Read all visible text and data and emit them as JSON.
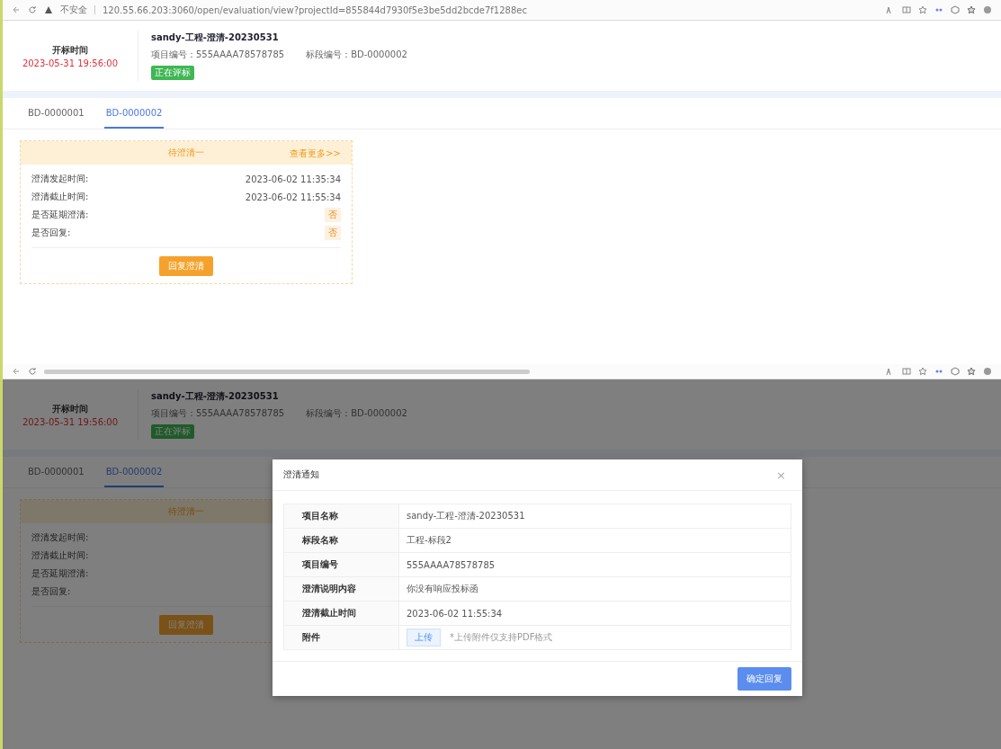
{
  "screens": [
    {
      "dimmed": false,
      "browser": {
        "security": "不安全",
        "url": "120.55.66.203:3060/open/evaluation/view?projectId=855844d7930f5e3be5dd2bcde7f1288ec"
      },
      "header": {
        "label": "开标时间",
        "time": "2023-05-31 19:56:00",
        "title": "sandy-工程-澄清-20230531",
        "meta": [
          "项目编号：555AAAA78578785",
          "标段编号：BD-0000002"
        ],
        "status": "正在评标"
      },
      "tabs": [
        {
          "label": "BD-0000001",
          "selected": false
        },
        {
          "label": "BD-0000002",
          "selected": true
        }
      ],
      "card": {
        "title": "待澄清一",
        "link": "查看更多>>",
        "rows": [
          {
            "label": "澄清发起时间:",
            "value": "2023-06-02 11:35:34",
            "kind": "text"
          },
          {
            "label": "澄清截止时间:",
            "value": "2023-06-02 11:55:34",
            "kind": "text"
          },
          {
            "label": "是否延期澄清:",
            "value": "否",
            "kind": "tag"
          },
          {
            "label": "是否回复:",
            "value": "否",
            "kind": "tag"
          }
        ],
        "button": "回复澄清"
      }
    },
    {
      "dimmed": true,
      "header": {
        "label": "开标时间",
        "time": "2023-05-31 19:56:00",
        "title": "sandy-工程-澄清-20230531",
        "meta": [
          "项目编号：555AAAA78578785",
          "标段编号：BD-0000002"
        ],
        "status": "正在评标"
      },
      "tabs": [
        {
          "label": "BD-0000001",
          "selected": false
        },
        {
          "label": "BD-0000002",
          "selected": true
        }
      ],
      "card": {
        "title": "待澄清一",
        "rows": [
          {
            "label": "澄清发起时间:"
          },
          {
            "label": "澄清截止时间:"
          },
          {
            "label": "是否延期澄清:"
          },
          {
            "label": "是否回复:"
          }
        ],
        "button": "回复澄清"
      },
      "modal": {
        "title": "澄清通知",
        "close": "×",
        "rows": [
          {
            "label": "项目名称",
            "value": "sandy-工程-澄清-20230531",
            "kind": "text"
          },
          {
            "label": "标段名称",
            "value": "工程-标段2",
            "kind": "text"
          },
          {
            "label": "项目编号",
            "value": "555AAAA78578785",
            "kind": "text"
          },
          {
            "label": "澄清说明内容",
            "value": "你没有响应投标函",
            "kind": "text"
          },
          {
            "label": "澄清截止时间",
            "value": "2023-06-02 11:55:34",
            "kind": "text"
          },
          {
            "label": "附件",
            "kind": "upload",
            "button": "上传",
            "hint": "*上传附件仅支持PDF格式"
          }
        ],
        "button": "确定回复"
      }
    }
  ]
}
